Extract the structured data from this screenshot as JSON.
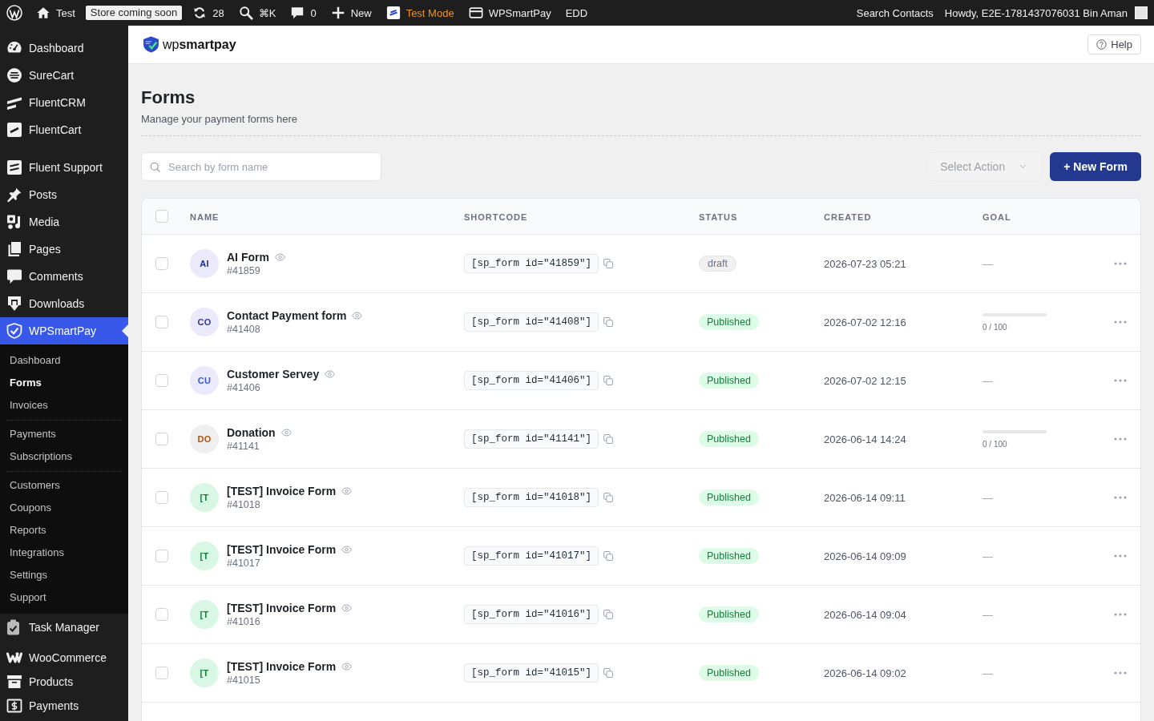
{
  "admin_bar": {
    "items": [
      {
        "kind": "link",
        "label": "Test"
      },
      {
        "kind": "badge",
        "label": "Store coming soon"
      },
      {
        "kind": "link",
        "label": "28"
      },
      {
        "kind": "link",
        "label": "⌘K"
      },
      {
        "kind": "link",
        "label": "0"
      },
      {
        "kind": "link",
        "label": "New"
      },
      {
        "kind": "warning",
        "label": "Test Mode"
      },
      {
        "kind": "link",
        "label": "WPSmartPay"
      },
      {
        "kind": "link",
        "label": "EDD"
      }
    ],
    "search_contacts": "Search Contacts",
    "greeting": "Howdy, E2E-1781437076031 Bin Aman"
  },
  "sidebar": {
    "groups": [
      {
        "items": [
          {
            "label": "Dashboard",
            "selected": false
          },
          {
            "label": "SureCart",
            "selected": false
          },
          {
            "label": "FluentCRM",
            "selected": false
          },
          {
            "label": "FluentCart",
            "selected": false
          }
        ]
      },
      {
        "items": [
          {
            "label": "Fluent Support",
            "selected": false
          },
          {
            "label": "Posts",
            "selected": false
          },
          {
            "label": "Media",
            "selected": false
          },
          {
            "label": "Pages",
            "selected": false
          },
          {
            "label": "Comments",
            "selected": false
          },
          {
            "label": "Downloads",
            "selected": false
          },
          {
            "label": "WPSmartPay",
            "selected": true,
            "submenu": [
              {
                "items": [
                  {
                    "label": "Dashboard",
                    "selected": false
                  },
                  {
                    "label": "Forms",
                    "selected": true
                  },
                  {
                    "label": "Invoices",
                    "selected": false
                  }
                ]
              },
              {
                "items": [
                  {
                    "label": "Payments",
                    "selected": false
                  },
                  {
                    "label": "Subscriptions",
                    "selected": false
                  }
                ]
              },
              {
                "items": [
                  {
                    "label": "Customers",
                    "selected": false
                  },
                  {
                    "label": "Coupons",
                    "selected": false
                  },
                  {
                    "label": "Reports",
                    "selected": false
                  },
                  {
                    "label": "Integrations",
                    "selected": false
                  },
                  {
                    "label": "Settings",
                    "selected": false
                  },
                  {
                    "label": "Support",
                    "selected": false
                  }
                ]
              }
            ]
          }
        ]
      },
      {
        "items": [
          {
            "label": "Task Manager",
            "selected": false
          }
        ]
      },
      {
        "items": [
          {
            "label": "WooCommerce",
            "selected": false
          },
          {
            "label": "Products",
            "selected": false
          },
          {
            "label": "Payments",
            "selected": false
          }
        ]
      }
    ]
  },
  "header": {
    "logo": "wp**smartpay**",
    "help_button": "Help"
  },
  "page": {
    "title": "Forms",
    "subtitle": "Manage your payment forms here"
  },
  "toolbar": {
    "search": {
      "placeholder": "Search by form name"
    },
    "bulk_action": {
      "placeholder": "Select Action"
    },
    "new_button": "+ New Form"
  },
  "table": {
    "select_all": {
      "checked": false
    },
    "columns": [
      "NAME",
      "SHORTCODE",
      "STATUS",
      "CREATED",
      "GOAL"
    ],
    "rows": [
      {
        "checked": false,
        "avatar": {
          "color": "#ebe9fc",
          "initials": {
            "text": "AI",
            "color": "#1e2f8a"
          }
        },
        "name": "AI Form",
        "id": "#41859",
        "shortcode": "[sp_form id=\"41859\"]",
        "status": {
          "label": "draft",
          "kind": "draft"
        },
        "created": "2026-07-23 05:21",
        "goal": {
          "kind": "none",
          "text": "—"
        }
      },
      {
        "checked": false,
        "avatar": {
          "color": "#ebe9fc",
          "initials": {
            "text": "CO",
            "color": "#2a3b9a"
          }
        },
        "name": "Contact Payment form",
        "id": "#41408",
        "shortcode": "[sp_form id=\"41408\"]",
        "status": {
          "label": "Published",
          "kind": "published"
        },
        "created": "2026-07-02 12:16",
        "goal": {
          "kind": "progress",
          "level": 0,
          "reading": "0 / 100"
        }
      },
      {
        "checked": false,
        "avatar": {
          "color": "#ebe9fc",
          "initials": {
            "text": "CU",
            "color": "#3b55e0"
          }
        },
        "name": "Customer Servey",
        "id": "#41406",
        "shortcode": "[sp_form id=\"41406\"]",
        "status": {
          "label": "Published",
          "kind": "published"
        },
        "created": "2026-07-02 12:15",
        "goal": {
          "kind": "none",
          "text": "—"
        }
      },
      {
        "checked": false,
        "avatar": {
          "color": "#efefef",
          "initials": {
            "text": "DO",
            "color": "#b5540a"
          }
        },
        "name": "Donation",
        "id": "#41141",
        "shortcode": "[sp_form id=\"41141\"]",
        "status": {
          "label": "Published",
          "kind": "published"
        },
        "created": "2026-06-14 14:24",
        "goal": {
          "kind": "progress",
          "level": 0,
          "reading": "0 / 100"
        }
      },
      {
        "checked": false,
        "avatar": {
          "color": "#d9f7e5",
          "initials": {
            "text": "[T",
            "color": "#15803d"
          }
        },
        "name": "[TEST] Invoice Form",
        "id": "#41018",
        "shortcode": "[sp_form id=\"41018\"]",
        "status": {
          "label": "Published",
          "kind": "published"
        },
        "created": "2026-06-14 09:11",
        "goal": {
          "kind": "none",
          "text": "—"
        }
      },
      {
        "checked": false,
        "avatar": {
          "color": "#d9f7e5",
          "initials": {
            "text": "[T",
            "color": "#15803d"
          }
        },
        "name": "[TEST] Invoice Form",
        "id": "#41017",
        "shortcode": "[sp_form id=\"41017\"]",
        "status": {
          "label": "Published",
          "kind": "published"
        },
        "created": "2026-06-14 09:09",
        "goal": {
          "kind": "none",
          "text": "—"
        }
      },
      {
        "checked": false,
        "avatar": {
          "color": "#d9f7e5",
          "initials": {
            "text": "[T",
            "color": "#15803d"
          }
        },
        "name": "[TEST] Invoice Form",
        "id": "#41016",
        "shortcode": "[sp_form id=\"41016\"]",
        "status": {
          "label": "Published",
          "kind": "published"
        },
        "created": "2026-06-14 09:04",
        "goal": {
          "kind": "none",
          "text": "—"
        }
      },
      {
        "checked": false,
        "avatar": {
          "color": "#d9f7e5",
          "initials": {
            "text": "[T",
            "color": "#15803d"
          }
        },
        "name": "[TEST] Invoice Form",
        "id": "#41015",
        "shortcode": "[sp_form id=\"41015\"]",
        "status": {
          "label": "Published",
          "kind": "published"
        },
        "created": "2026-06-14 09:02",
        "goal": {
          "kind": "none",
          "text": "—"
        }
      }
    ]
  }
}
